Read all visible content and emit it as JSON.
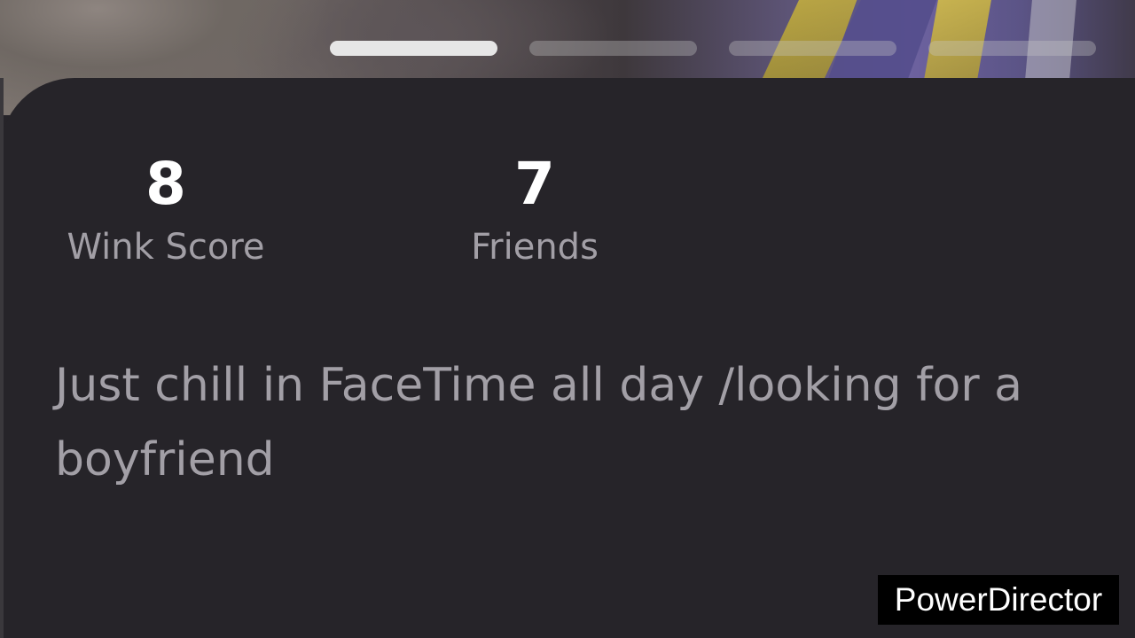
{
  "story": {
    "progress": [
      {
        "state": "active"
      },
      {
        "state": "inactive"
      },
      {
        "state": "inactive"
      },
      {
        "state": "inactive"
      }
    ]
  },
  "profile": {
    "stats": {
      "wink_score": {
        "value": "8",
        "label": "Wink Score"
      },
      "friends": {
        "value": "7",
        "label": "Friends"
      }
    },
    "bio": "Just chill in FaceTime all day /looking for a boyfriend"
  },
  "watermark": {
    "text": "PowerDirector"
  },
  "colors": {
    "card_background": "#262429",
    "value_text": "#ffffff",
    "secondary_text": "#a29fa6",
    "progress_active": "#e6e6e6"
  }
}
